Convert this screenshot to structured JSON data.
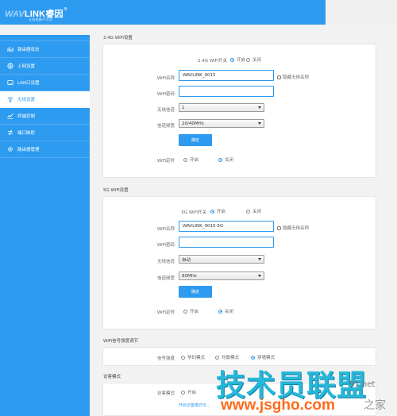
{
  "brand": {
    "logo_mark": "WAV",
    "logo_text": "LINK",
    "logo_cn": "睿因",
    "logo_reg": "®",
    "tagline": "让网络触手可及"
  },
  "sidebar": {
    "items": [
      {
        "label": "路由器状态",
        "icon": "status-icon"
      },
      {
        "label": "上网设置",
        "icon": "globe-icon"
      },
      {
        "label": "LAN口设置",
        "icon": "lan-icon"
      },
      {
        "label": "无线设置",
        "icon": "wifi-icon",
        "active": true
      },
      {
        "label": "终端控制",
        "icon": "chart-icon"
      },
      {
        "label": "端口映射",
        "icon": "port-icon"
      },
      {
        "label": "路由器管理",
        "icon": "gear-icon"
      }
    ]
  },
  "wifi24": {
    "section_title": "2.4G WiFi设置",
    "switch_label": "2.4G WiFi开关",
    "switch_on": "开启",
    "switch_off": "关闭",
    "name_label": "WiFi名称",
    "name_value": "WAVLINK_0015",
    "hide_label": "隐藏无线名称",
    "password_label": "WiFi密码",
    "password_value": "",
    "channel_label": "无线信道",
    "channel_value": "1",
    "bandwidth_label": "信道频宽",
    "bandwidth_value": "20/40MHz",
    "confirm": "确定",
    "timer_label": "WiFi定时",
    "timer_on": "开启",
    "timer_off": "关闭"
  },
  "wifi5": {
    "section_title": "5G WiFi设置",
    "switch_label": "5G WiFi开关",
    "switch_on": "开启",
    "switch_off": "关闭",
    "name_label": "WiFi名称",
    "name_value": "WAVLINK_0015-5G",
    "hide_label": "隐藏无线名称",
    "password_label": "WiFi密码",
    "password_value": "",
    "channel_label": "无线信道",
    "channel_value": "自动",
    "bandwidth_label": "信道频宽",
    "bandwidth_value": "80MHz",
    "confirm": "确定",
    "timer_label": "WiFi定时",
    "timer_on": "开启",
    "timer_off": "关闭"
  },
  "signal": {
    "section_title": "WiFi信号强度调节",
    "label": "信号强度",
    "opt1": "孕妇模式",
    "opt2": "均衡模式",
    "opt3": "穿墙模式"
  },
  "guest": {
    "section_title": "访客模式",
    "label": "访客模式",
    "opt_on": "开启",
    "hint": "开启访客模式可..."
  },
  "watermark": {
    "text": "技术员联盟",
    "url": "www.jsgho.com",
    "side": "51.net",
    "side2": "之家"
  },
  "colors": {
    "accent": "#2d9bf0",
    "watermark": "#27b7d8",
    "watermark_url": "#ff6a1a"
  }
}
